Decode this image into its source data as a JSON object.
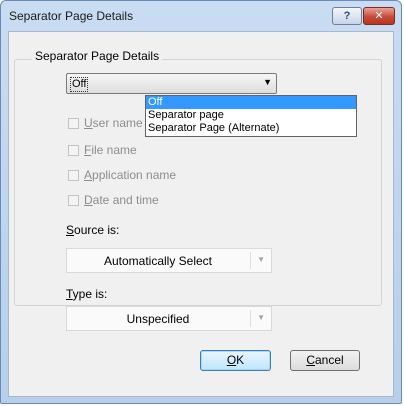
{
  "window": {
    "title": "Separator Page Details",
    "help_label": "?",
    "close_label": "✕"
  },
  "group": {
    "label": "Separator Page Details"
  },
  "separator_select": {
    "value": "Off",
    "options": [
      "Off",
      "Separator page",
      "Separator Page (Alternate)"
    ],
    "highlighted_index": 0
  },
  "checkboxes": [
    {
      "accel": "U",
      "rest": "ser name",
      "checked": false,
      "enabled": false
    },
    {
      "accel": "F",
      "rest": "ile name",
      "checked": false,
      "enabled": false
    },
    {
      "accel": "A",
      "rest": "pplication name",
      "checked": false,
      "enabled": false
    },
    {
      "accel": "D",
      "rest": "ate and time",
      "checked": false,
      "enabled": false
    }
  ],
  "source": {
    "label_accel": "S",
    "label_rest": "ource is:",
    "value": "Automatically Select"
  },
  "type": {
    "label_accel": "T",
    "label_rest": "ype is:",
    "value": "Unspecified"
  },
  "buttons": {
    "ok_accel": "O",
    "ok_rest": "K",
    "cancel_accel": "C",
    "cancel_rest": "ancel"
  }
}
